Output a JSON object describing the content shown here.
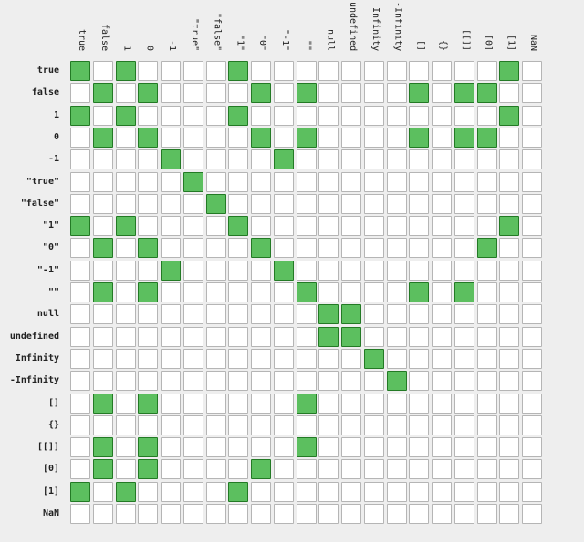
{
  "labels": [
    "true",
    "false",
    "1",
    "0",
    "-1",
    "\"true\"",
    "\"false\"",
    "\"1\"",
    "\"0\"",
    "\"-1\"",
    "\"\"",
    "null",
    "undefined",
    "Infinity",
    "-Infinity",
    "[]",
    "{}",
    "[[]]",
    "[0]",
    "[1]",
    "NaN"
  ],
  "colors": {
    "equal": "#5cbf5f",
    "equal_border": "#237a25",
    "not_equal": "#ffffff"
  },
  "matrix": [
    [
      0,
      2,
      7,
      19
    ],
    [
      1,
      3,
      8,
      10,
      15,
      17,
      18
    ],
    [
      0,
      2,
      7,
      19
    ],
    [
      1,
      3,
      8,
      10,
      15,
      17,
      18
    ],
    [
      4,
      9
    ],
    [
      5
    ],
    [
      6
    ],
    [
      0,
      2,
      7,
      19
    ],
    [
      1,
      3,
      8,
      18
    ],
    [
      4,
      9
    ],
    [
      1,
      3,
      10,
      15,
      17
    ],
    [
      11,
      12
    ],
    [
      11,
      12
    ],
    [
      13
    ],
    [
      14
    ],
    [
      1,
      3,
      10
    ],
    [],
    [
      1,
      3,
      10
    ],
    [
      1,
      3,
      8
    ],
    [
      0,
      2,
      7
    ],
    []
  ]
}
